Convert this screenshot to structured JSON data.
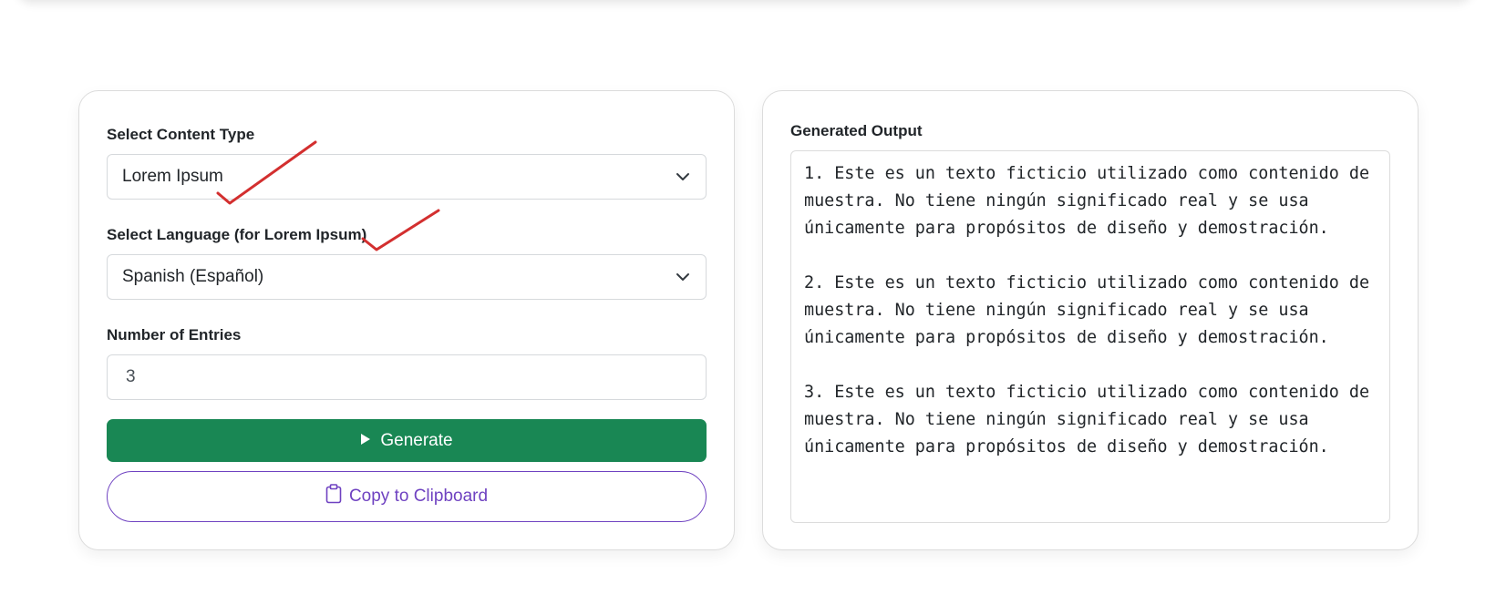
{
  "form": {
    "content_type_label": "Select Content Type",
    "content_type_value": "Lorem Ipsum",
    "language_label": "Select Language (for Lorem Ipsum)",
    "language_value": "Spanish (Español)",
    "entries_label": "Number of Entries",
    "entries_value": "3",
    "generate_label": "Generate",
    "copy_label": "Copy to Clipboard"
  },
  "output": {
    "label": "Generated Output",
    "text": "1. Este es un texto ficticio utilizado como contenido de muestra. No tiene ningún significado real y se usa únicamente para propósitos de diseño y demostración.\n\n2. Este es un texto ficticio utilizado como contenido de muestra. No tiene ningún significado real y se usa únicamente para propósitos de diseño y demostración.\n\n3. Este es un texto ficticio utilizado como contenido de muestra. No tiene ningún significado real y se usa únicamente para propósitos de diseño y demostración."
  },
  "colors": {
    "generate_bg": "#198754",
    "copy_accent": "#6f42c1",
    "annotation_mark": "#d32f2f"
  },
  "icons": {
    "generate": "play-icon",
    "copy": "clipboard-icon",
    "select": "chevron-down-icon"
  }
}
